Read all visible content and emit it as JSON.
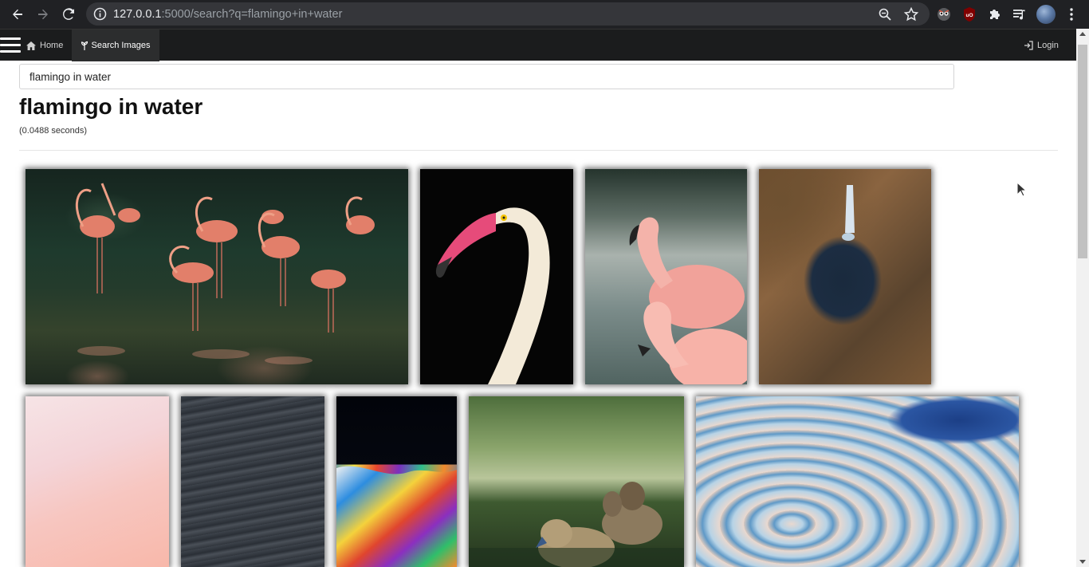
{
  "browser": {
    "url_host": "127.0.0.1",
    "url_rest": ":5000/search?q=flamingo+in+water",
    "icons": [
      "back-arrow-icon",
      "forward-arrow-icon",
      "reload-icon",
      "info-icon",
      "zoom-icon",
      "star-icon",
      "extension-icon",
      "puzzle-icon",
      "media-icon",
      "profile-avatar",
      "kebab-menu-icon"
    ]
  },
  "navbar": {
    "home_label": "Home",
    "search_label": "Search Images",
    "login_label": "Login"
  },
  "search": {
    "query_value": "flamingo in water",
    "title": "flamingo in water",
    "timing": "(0.0488 seconds)"
  },
  "results": [
    {
      "subject": "flamingos-wading-in-pond"
    },
    {
      "subject": "flamingo-head-on-black"
    },
    {
      "subject": "two-flamingos-in-water"
    },
    {
      "subject": "aerial-pond-in-forest"
    },
    {
      "subject": "pink-water-texture"
    },
    {
      "subject": "dark-water-ripples"
    },
    {
      "subject": "oil-slick-colors"
    },
    {
      "subject": "ducklings-in-pond"
    },
    {
      "subject": "blue-marble-abstract"
    }
  ],
  "colors": {
    "chrome_bg": "#202124",
    "navbar_bg": "#1b1c1d",
    "active_tab_bg": "#2c2d2e"
  }
}
